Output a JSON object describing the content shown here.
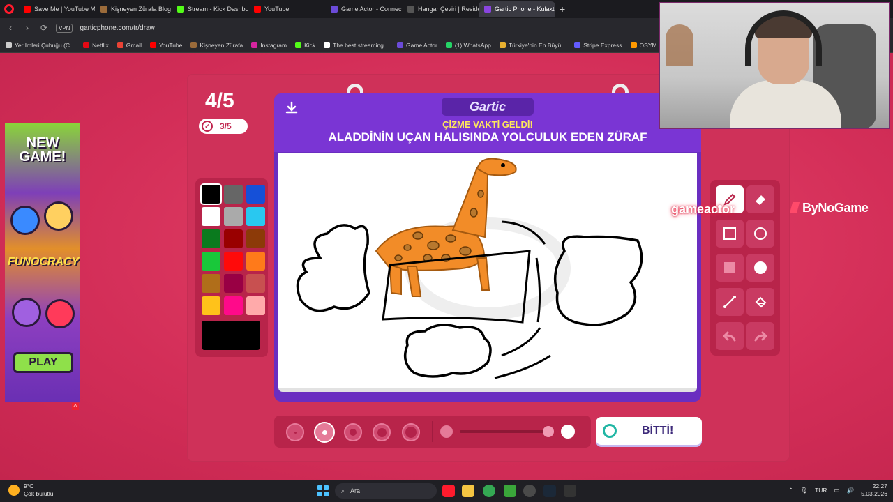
{
  "browser": {
    "tabs": [
      {
        "label": "Save Me | YouTube M",
        "color": "#ff0000"
      },
      {
        "label": "Kişneyen Zürafa Blog",
        "color": "#9b6b3a"
      },
      {
        "label": "Stream - Kick Dashboard",
        "color": "#53fc18"
      },
      {
        "label": "YouTube",
        "color": "#ff0000"
      },
      {
        "label": "Game Actor - Connect wit",
        "color": "#6b4bd8"
      },
      {
        "label": "Hangar Çeviri | Resident E",
        "color": "#555555"
      },
      {
        "label": "Gartic Phone - Kulaktan K",
        "color": "#8a45e0"
      }
    ],
    "new_tab": "+",
    "vpn": "VPN",
    "url": "garticphone.com/tr/draw",
    "bookmarks": [
      {
        "label": "Yer İmleri Çubuğu (C...",
        "color": "#cccccc"
      },
      {
        "label": "Netflix",
        "color": "#e50914"
      },
      {
        "label": "Gmail",
        "color": "#ea4335"
      },
      {
        "label": "YouTube",
        "color": "#ff0000"
      },
      {
        "label": "Kişneyen Zürafa",
        "color": "#9b6b3a"
      },
      {
        "label": "Instagram",
        "color": "#d6249f"
      },
      {
        "label": "Kick",
        "color": "#53fc18"
      },
      {
        "label": "The best streaming...",
        "color": "#ffffff"
      },
      {
        "label": "Game Actor",
        "color": "#6b4bd8"
      },
      {
        "label": "(1) WhatsApp",
        "color": "#25d366"
      },
      {
        "label": "Türkiye'nin En Büyü...",
        "color": "#e8b030"
      },
      {
        "label": "Stripe Express",
        "color": "#635bff"
      },
      {
        "label": "ÖSYM Aday İşlemle...",
        "color": "#ff9900"
      }
    ]
  },
  "ad": {
    "headline": "NEW GAME!",
    "brand": "FUNOCRACY",
    "cta": "PLAY",
    "badge": "A"
  },
  "game": {
    "round": "4/5",
    "done_count": "3/5",
    "logo": "Gartic",
    "subheading": "ÇİZME VAKTİ GELDİ!",
    "prompt": "ALADDİNİN UÇAN HALISINDA YOLCULUK EDEN ZÜRAF",
    "done_button": "BİTTİ!",
    "palette": [
      "#000000",
      "#666666",
      "#1550d8",
      "#ffffff",
      "#aaaaaa",
      "#29c8f0",
      "#0a7a1e",
      "#990000",
      "#8c3a08",
      "#19c83a",
      "#ff0a0a",
      "#ff7a1a",
      "#b06e1a",
      "#990044",
      "#c85050",
      "#ffc21a",
      "#ff0a8a",
      "#ffaaaa"
    ],
    "selected_color": "#000000",
    "brush_sizes": 5,
    "selected_brush_index": 1
  },
  "overlay": {
    "sponsor_left": "gameactor",
    "sponsor_right": "ByNoGame"
  },
  "taskbar": {
    "temperature": "9°C",
    "weather": "Çok bulutlu",
    "search_placeholder": "Ara",
    "language": "TUR",
    "time": "22:27",
    "date": "5.03.2026"
  }
}
